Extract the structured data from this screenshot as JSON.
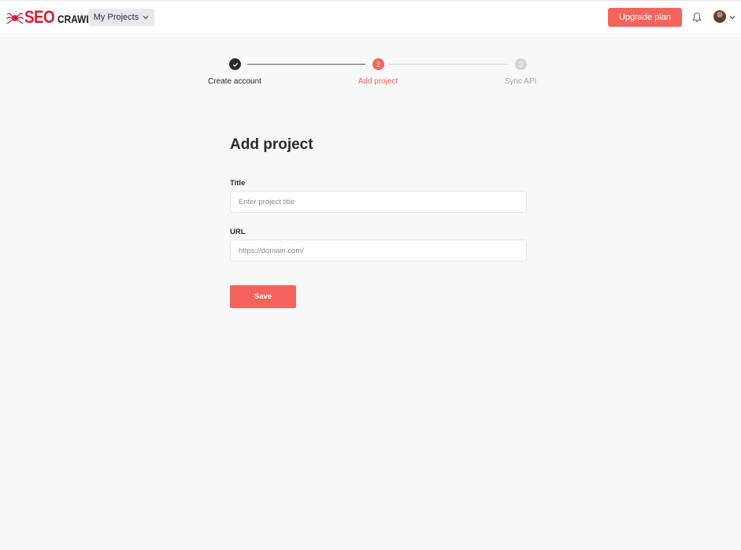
{
  "brand": {
    "seo": "SEO",
    "crawl": "CRAWL",
    "accent": "#d61f36"
  },
  "header": {
    "projects_label": "My Projects",
    "upgrade_label": "Upgrade plan",
    "bell_icon": "bell-icon",
    "avatar_icon": "avatar"
  },
  "stepper": {
    "steps": [
      {
        "number": "1",
        "label": "Create account",
        "state": "completed",
        "color": "#2b2b2b"
      },
      {
        "number": "2",
        "label": "Add project",
        "state": "active",
        "color": "#f4635b"
      },
      {
        "number": "3",
        "label": "Sync API",
        "state": "pending",
        "color": "#c8c8cc"
      }
    ]
  },
  "form": {
    "title": "Add project",
    "title_label": "Title",
    "title_placeholder": "Enter project title",
    "title_value": "",
    "url_label": "URL",
    "url_placeholder": "https://domain.com/",
    "url_value": "",
    "save_label": "Save"
  },
  "colors": {
    "primary": "#f4635b",
    "background": "#f8f8f9"
  }
}
